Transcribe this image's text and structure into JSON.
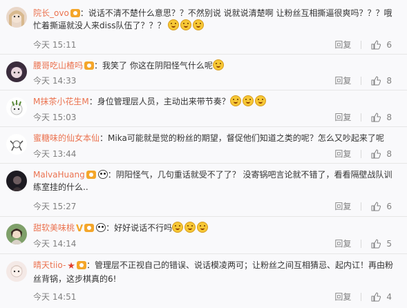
{
  "comments": [
    {
      "username": "院长_ovo",
      "text": "说话不清不楚什么意思？？不然别说 说就说清楚啊 让粉丝互相撕逼很爽吗？？？哦忙着撕逼就没人来diss队伍了？？？",
      "time": "今天 15:11",
      "reply_label": "回复",
      "likes": "6"
    },
    {
      "username": "腰哥吃山楂吗",
      "text": "我笑了 你这在阴阳怪气什么呢",
      "time": "今天 14:33",
      "reply_label": "回复",
      "likes": "8"
    },
    {
      "username": "M抹茶小花生M",
      "text": "身位管理层人员，主动出来带节奏？",
      "time": "今天 15:03",
      "reply_label": "回复",
      "likes": "8"
    },
    {
      "username": "蜜糖味的仙女本仙",
      "text": "Mika可能就是觉的粉丝的期望，督促他们知道之类的呢？怎么又吵起来了呢",
      "time": "今天 13:44",
      "reply_label": "回复",
      "likes": "8"
    },
    {
      "username": "MalvaHuang",
      "text": "阴阳怪气，几句重话就受不了了？ 没寄锅吧言论就不错了，看看隔壁战队训练室挂的什么..",
      "time": "今天 15:27",
      "reply_label": "回复",
      "likes": "6"
    },
    {
      "username": "甜软美味桃",
      "text": "好好说话不行吗",
      "time": "今天 14:14",
      "reply_label": "回复",
      "likes": "5"
    },
    {
      "username": "晴天tiio-",
      "text": "管理层不正视自己的错误、说话模凌两可；让粉丝之间互相猜忌、起内讧！再由粉丝背锅，这步棋真的6!",
      "time": "今天 14:51",
      "reply_label": "回复",
      "likes": "4"
    }
  ],
  "colors": {
    "username": "#eb7350",
    "meta": "#808080",
    "text": "#333333"
  }
}
